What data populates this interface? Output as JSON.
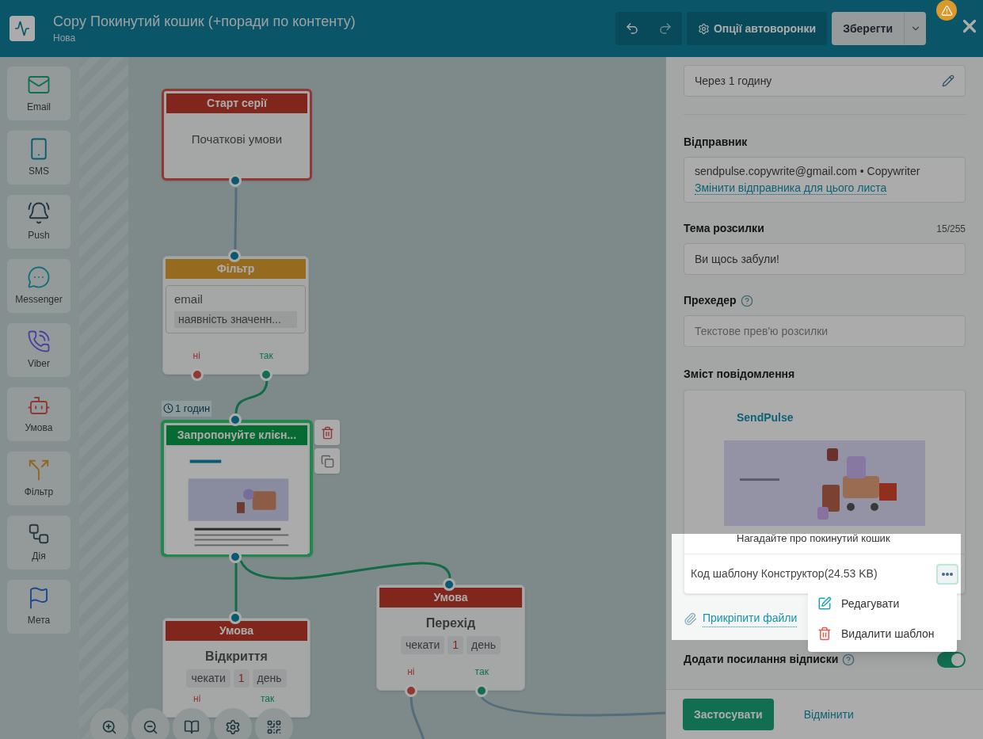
{
  "header": {
    "title": "Copy Покинутий кошик (+поради по контенту)",
    "subtitle": "Нова",
    "options_button": "Опції автоворонки",
    "save_button": "Зберегти"
  },
  "tools": [
    {
      "kind": "email",
      "label": "Email"
    },
    {
      "kind": "sms",
      "label": "SMS"
    },
    {
      "kind": "push",
      "label": "Push"
    },
    {
      "kind": "messenger",
      "label": "Messenger"
    },
    {
      "kind": "viber",
      "label": "Viber"
    },
    {
      "kind": "condition",
      "label": "Умова"
    },
    {
      "kind": "filter",
      "label": "Фільтр"
    },
    {
      "kind": "action",
      "label": "Дія"
    },
    {
      "kind": "goal",
      "label": "Мета"
    }
  ],
  "nodes": [
    {
      "kind": "start",
      "title": "Старт серії",
      "body": "Початкові умови",
      "selected": false
    },
    {
      "kind": "filter",
      "title": "Фільтр",
      "field": "email",
      "condition": "наявність значенн...",
      "outputs": [
        "ні",
        "так"
      ],
      "selected": false
    },
    {
      "kind": "email",
      "title": "Запропонуйте клієн...",
      "delay": "1 годин",
      "selected": true
    },
    {
      "kind": "condition",
      "title": "Умова",
      "body": "Відкриття",
      "wait": [
        "чекати",
        "1",
        "день"
      ],
      "outputs": [
        "ні",
        "так"
      ],
      "selected": false
    },
    {
      "kind": "condition",
      "title": "Умова",
      "body": "Перехід",
      "wait": [
        "чекати",
        "1",
        "день"
      ],
      "outputs": [
        "ні",
        "так"
      ],
      "selected": false
    }
  ],
  "panel": {
    "timing": "Через 1 годину",
    "sender": {
      "label": "Відправник",
      "value": "sendpulse.copywrite@gmail.com • Copywriter",
      "link": "Змінити відправника для цього листа"
    },
    "subject": {
      "label": "Тема розсилки",
      "counter": "15/255",
      "value": "Ви щось забули!"
    },
    "preheader": {
      "label": "Прехедер",
      "placeholder": "Текстове прев'ю розсилки"
    },
    "content": {
      "label": "Зміст повідомлення",
      "logo": "SendPulse",
      "caption": "Нагадайте про покинутий кошик",
      "template": "Код шаблону Конструктор(24.53 KB)"
    },
    "menu": [
      {
        "kind": "edit",
        "label": "Редагувати"
      },
      {
        "kind": "delete",
        "label": "Видалити шаблон"
      }
    ],
    "attach": "Прикріпити файли",
    "unsubscribe": {
      "label": "Додати посилання відписки",
      "on": true
    },
    "apply": "Застосувати",
    "cancel": "Відмінити"
  }
}
